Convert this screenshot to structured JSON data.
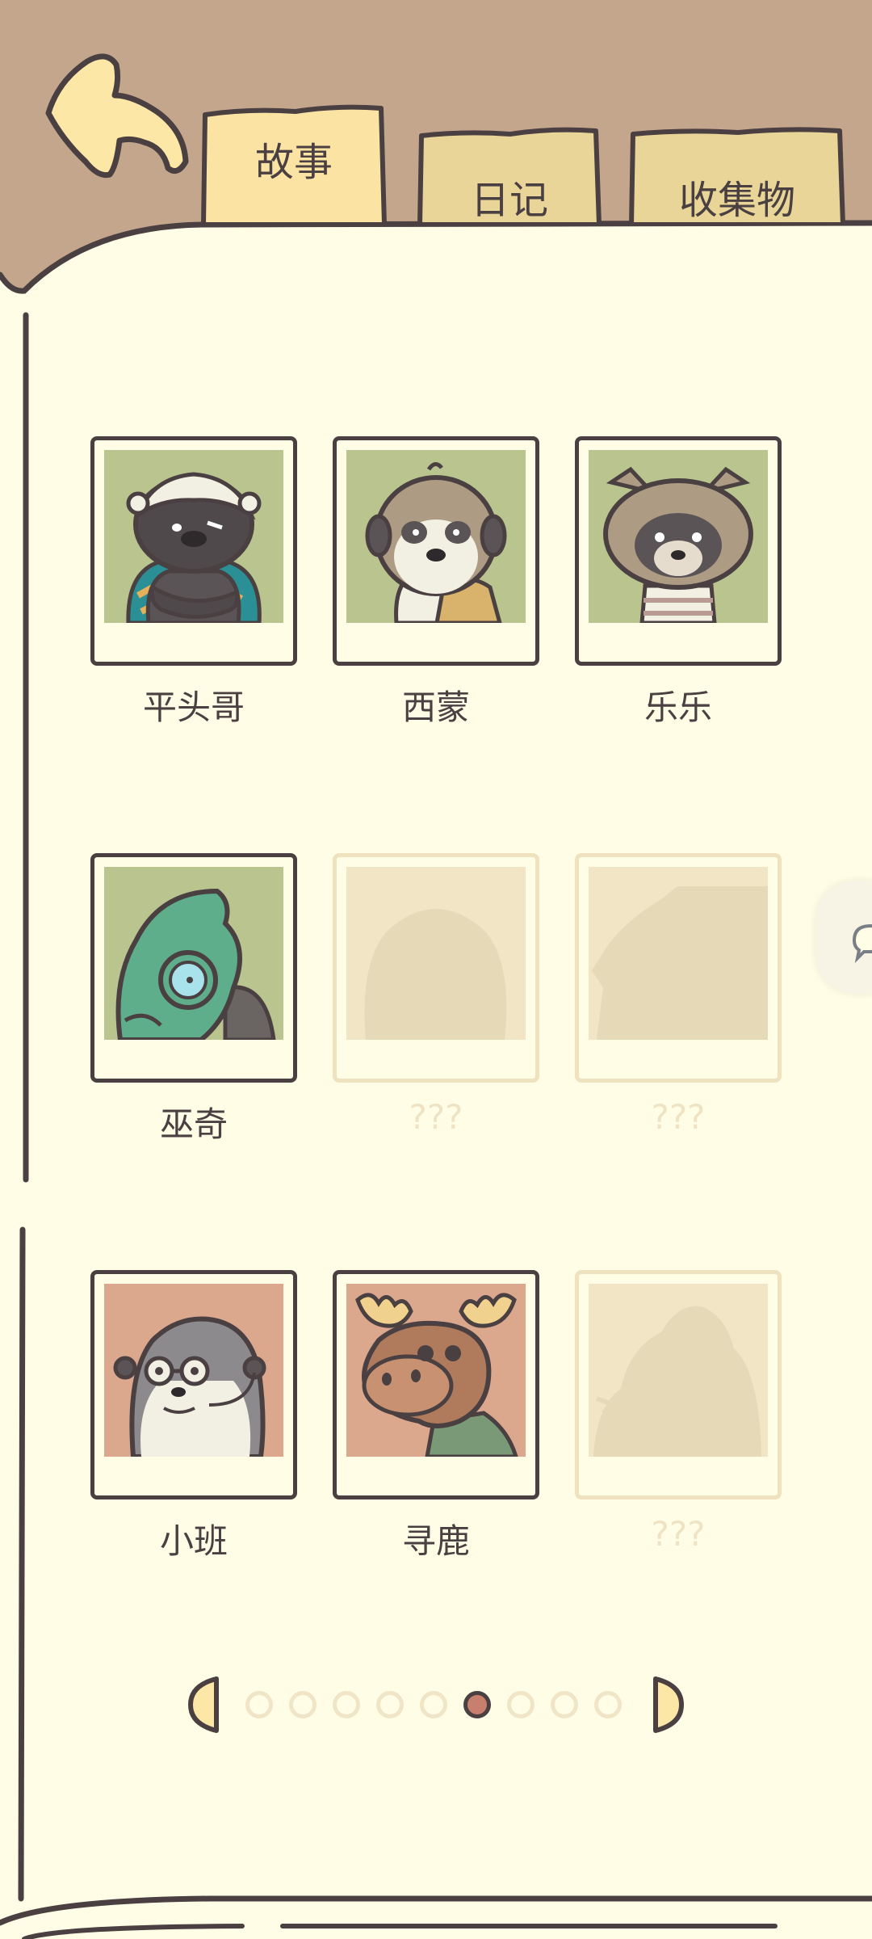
{
  "tabs": [
    {
      "label": "故事",
      "active": true
    },
    {
      "label": "日记",
      "active": false
    },
    {
      "label": "收集物",
      "active": false
    }
  ],
  "characters": [
    {
      "name": "平头哥",
      "unlocked": true,
      "bg": "#b9c48f",
      "icon": "honey-badger-portrait"
    },
    {
      "name": "西蒙",
      "unlocked": true,
      "bg": "#b9c48f",
      "icon": "meerkat-portrait"
    },
    {
      "name": "乐乐",
      "unlocked": true,
      "bg": "#b9c48f",
      "icon": "raccoon-dog-portrait"
    },
    {
      "name": "巫奇",
      "unlocked": true,
      "bg": "#b9c48f",
      "icon": "chameleon-portrait"
    },
    {
      "name": "???",
      "unlocked": false,
      "icon": "locked-silhouette"
    },
    {
      "name": "???",
      "unlocked": false,
      "icon": "locked-silhouette"
    },
    {
      "name": "小班",
      "unlocked": true,
      "bg": "#dba88e",
      "icon": "otter-portrait"
    },
    {
      "name": "寻鹿",
      "unlocked": true,
      "bg": "#dba88e",
      "icon": "moose-portrait"
    },
    {
      "name": "???",
      "unlocked": false,
      "icon": "locked-silhouette"
    }
  ],
  "pagination": {
    "total": 9,
    "current": 6
  },
  "colors": {
    "outline": "#4a4042",
    "paper": "#fffde6",
    "header": "#c4a68d",
    "tab": "#fbe4a3",
    "tab_inactive": "#e8d597",
    "active_dot": "#c97f6d"
  }
}
